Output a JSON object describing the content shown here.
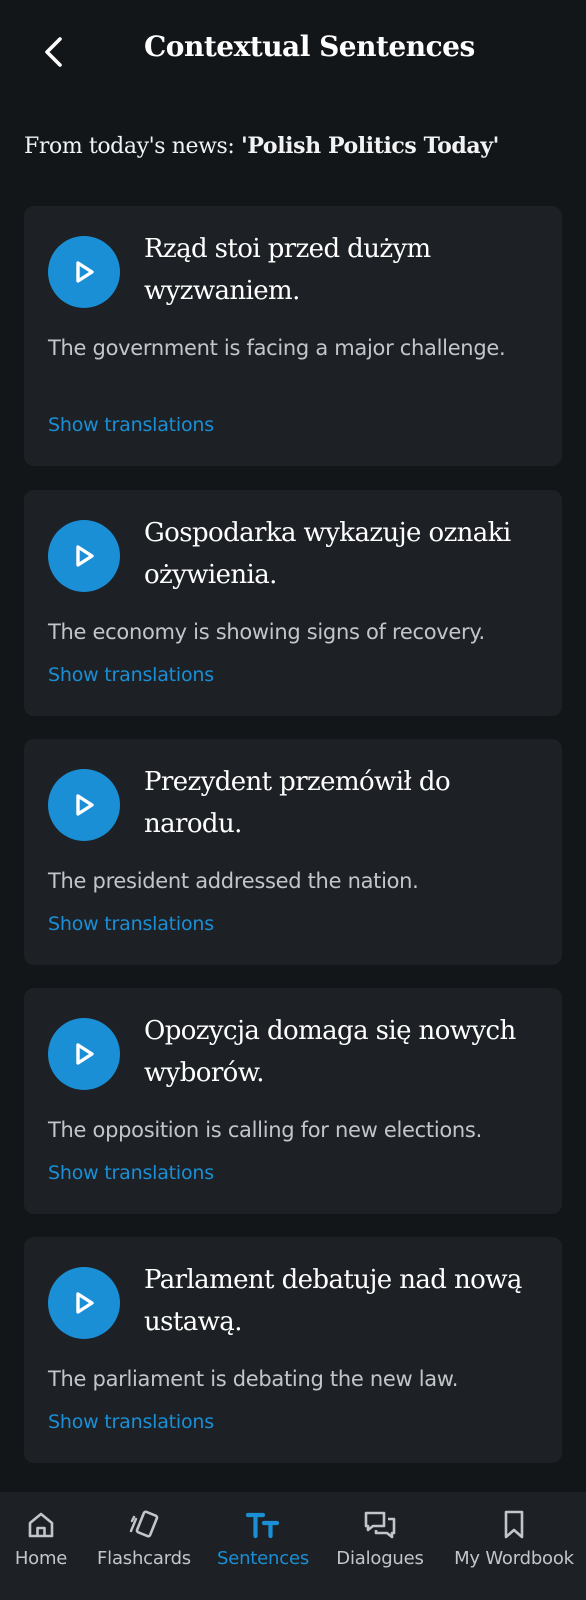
{
  "header": {
    "title": "Contextual Sentences",
    "back_icon": "chevron-left-icon"
  },
  "source": {
    "prefix": "From today's news:",
    "article_title": "'Polish Politics Today'"
  },
  "sentences": [
    {
      "polish": "Rząd stoi przed dużym wyzwaniem.",
      "english": "The government is facing a major challenge.",
      "show_label": "Show translations"
    },
    {
      "polish": "Gospodarka wykazuje oznaki ożywienia.",
      "english": "The economy is showing signs of recovery.",
      "show_label": "Show translations"
    },
    {
      "polish": "Prezydent przemówił do narodu.",
      "english": "The president addressed the nation.",
      "show_label": "Show translations"
    },
    {
      "polish": "Opozycja domaga się nowych wyborów.",
      "english": "The opposition is calling for new elections.",
      "show_label": "Show translations"
    },
    {
      "polish": "Parlament debatuje nad nową ustawą.",
      "english": "The parliament is debating the new law.",
      "show_label": "Show translations"
    }
  ],
  "bottom_nav": {
    "items": [
      {
        "label": "Home",
        "icon": "home-icon",
        "active": false
      },
      {
        "label": "Flashcards",
        "icon": "flashcards-icon",
        "active": false
      },
      {
        "label": "Sentences",
        "icon": "text-size-icon",
        "active": true
      },
      {
        "label": "Dialogues",
        "icon": "chat-bubbles-icon",
        "active": false
      },
      {
        "label": "My Wordbook",
        "icon": "bookmark-icon",
        "active": false
      }
    ]
  },
  "colors": {
    "background": "#121619",
    "card": "#1d2125",
    "accent": "#1a8fd6",
    "muted_text": "#c3c6c9"
  }
}
